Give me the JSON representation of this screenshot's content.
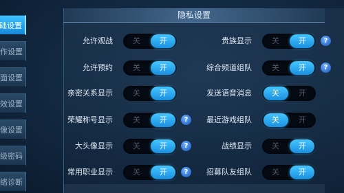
{
  "sidebar": {
    "tabs": [
      {
        "label": "础设置",
        "active": true
      },
      {
        "label": "作设置",
        "active": false
      },
      {
        "label": "面设置",
        "active": false
      },
      {
        "label": "效设置",
        "active": false
      },
      {
        "label": "像设置",
        "active": false
      },
      {
        "label": "级密码",
        "active": false
      },
      {
        "label": "络诊断",
        "active": false
      }
    ]
  },
  "panel": {
    "title": "隐私设置"
  },
  "toggle_labels": {
    "off": "关",
    "on": "开"
  },
  "settings": {
    "left": [
      {
        "label": "允许观战",
        "on": true,
        "help": false
      },
      {
        "label": "允许预约",
        "on": true,
        "help": false
      },
      {
        "label": "亲密关系显示",
        "on": true,
        "help": false
      },
      {
        "label": "荣耀称号显示",
        "on": true,
        "help": true
      },
      {
        "label": "大头像显示",
        "on": true,
        "help": true
      },
      {
        "label": "常用职业显示",
        "on": true,
        "help": true
      }
    ],
    "right": [
      {
        "label": "贵族显示",
        "on": true,
        "help": true
      },
      {
        "label": "综合频道组队",
        "on": true,
        "help": true
      },
      {
        "label": "发送语音消息",
        "on": false,
        "help": false
      },
      {
        "label": "最近游戏组队",
        "on": false,
        "help": false
      },
      {
        "label": "战绩显示",
        "on": true,
        "help": false
      },
      {
        "label": "招募队友组队",
        "on": true,
        "help": false
      }
    ],
    "help_symbol": "?"
  },
  "colors": {
    "accent": "#2aa8f0",
    "track": "#050a12",
    "help": "#3a7ee0"
  }
}
